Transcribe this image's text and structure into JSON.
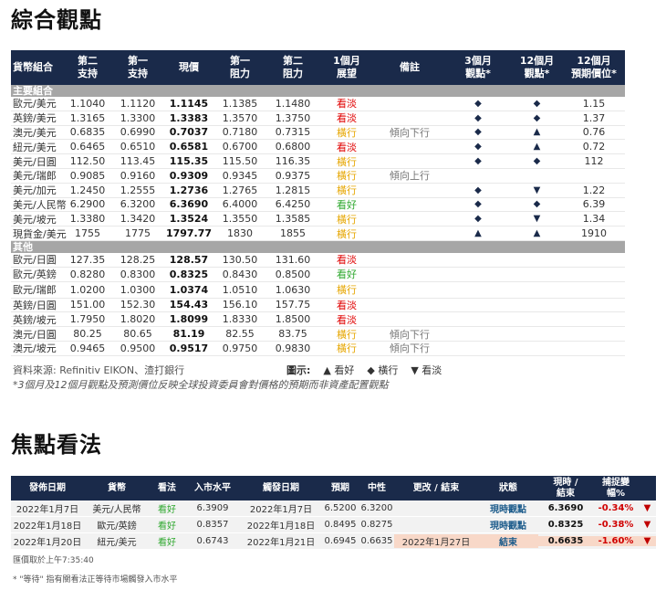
{
  "title1": "綜合觀點",
  "table1": {
    "headers": [
      "貨幣組合",
      "第二\n支持",
      "第一\n支持",
      "現價",
      "第一\n阻力",
      "第二\n阻力",
      "1個月\n展望",
      "備註",
      "3個月\n觀點*",
      "12個月\n觀點*",
      "12個月\n預期價位*"
    ],
    "section_main": "主要組合",
    "main_rows": [
      {
        "pair": "歐元/美元",
        "s2": "1.1040",
        "s1": "1.1120",
        "px": "1.1145",
        "r1": "1.1385",
        "r2": "1.1480",
        "outlook": "看淡",
        "tone": "bear",
        "note": "",
        "m3": "◆",
        "m12": "◆",
        "target": "1.15"
      },
      {
        "pair": "英鎊/美元",
        "s2": "1.3165",
        "s1": "1.3300",
        "px": "1.3383",
        "r1": "1.3570",
        "r2": "1.3750",
        "outlook": "看淡",
        "tone": "bear",
        "note": "",
        "m3": "◆",
        "m12": "◆",
        "target": "1.37"
      },
      {
        "pair": "澳元/美元",
        "s2": "0.6835",
        "s1": "0.6990",
        "px": "0.7037",
        "r1": "0.7180",
        "r2": "0.7315",
        "outlook": "橫行",
        "tone": "neut",
        "note": "傾向下行",
        "m3": "◆",
        "m12": "▲",
        "target": "0.76"
      },
      {
        "pair": "紐元/美元",
        "s2": "0.6465",
        "s1": "0.6510",
        "px": "0.6581",
        "r1": "0.6700",
        "r2": "0.6800",
        "outlook": "看淡",
        "tone": "bear",
        "note": "",
        "m3": "◆",
        "m12": "▲",
        "target": "0.72"
      },
      {
        "pair": "美元/日圓",
        "s2": "112.50",
        "s1": "113.45",
        "px": "115.35",
        "r1": "115.50",
        "r2": "116.35",
        "outlook": "橫行",
        "tone": "neut",
        "note": "",
        "m3": "◆",
        "m12": "◆",
        "target": "112"
      },
      {
        "pair": "美元/瑞郎",
        "s2": "0.9085",
        "s1": "0.9160",
        "px": "0.9309",
        "r1": "0.9345",
        "r2": "0.9375",
        "outlook": "橫行",
        "tone": "neut",
        "note": "傾向上行",
        "m3": "",
        "m12": "",
        "target": ""
      },
      {
        "pair": "美元/加元",
        "s2": "1.2450",
        "s1": "1.2555",
        "px": "1.2736",
        "r1": "1.2765",
        "r2": "1.2815",
        "outlook": "橫行",
        "tone": "neut",
        "note": "",
        "m3": "◆",
        "m12": "▼",
        "target": "1.22"
      },
      {
        "pair": "美元/人民幣",
        "s2": "6.2900",
        "s1": "6.3200",
        "px": "6.3690",
        "r1": "6.4000",
        "r2": "6.4250",
        "outlook": "看好",
        "tone": "bull",
        "note": "",
        "m3": "◆",
        "m12": "◆",
        "target": "6.39"
      },
      {
        "pair": "美元/坡元",
        "s2": "1.3380",
        "s1": "1.3420",
        "px": "1.3524",
        "r1": "1.3550",
        "r2": "1.3585",
        "outlook": "橫行",
        "tone": "neut",
        "note": "",
        "m3": "◆",
        "m12": "▼",
        "target": "1.34"
      },
      {
        "pair": "現貨金/美元",
        "s2": "1755",
        "s1": "1775",
        "px": "1797.77",
        "r1": "1830",
        "r2": "1855",
        "outlook": "橫行",
        "tone": "neut",
        "note": "",
        "m3": "▲",
        "m12": "▲",
        "target": "1910"
      }
    ],
    "section_other": "其他",
    "other_rows": [
      {
        "pair": "歐元/日圓",
        "s2": "127.35",
        "s1": "128.25",
        "px": "128.57",
        "r1": "130.50",
        "r2": "131.60",
        "outlook": "看淡",
        "tone": "bear",
        "note": "",
        "tall": false
      },
      {
        "pair": "歐元/英鎊",
        "s2": "0.8280",
        "s1": "0.8300",
        "px": "0.8325",
        "r1": "0.8430",
        "r2": "0.8500",
        "outlook": "看好",
        "tone": "bull",
        "note": "",
        "tall": false
      },
      {
        "pair": "歐元/瑞郎",
        "s2": "1.0200",
        "s1": "1.0300",
        "px": "1.0374",
        "r1": "1.0510",
        "r2": "1.0630",
        "outlook": "橫行",
        "tone": "neut",
        "note": "",
        "tall": true
      },
      {
        "pair": "英鎊/日圓",
        "s2": "151.00",
        "s1": "152.30",
        "px": "154.43",
        "r1": "156.10",
        "r2": "157.75",
        "outlook": "看淡",
        "tone": "bear",
        "note": "",
        "tall": false
      },
      {
        "pair": "英鎊/坡元",
        "s2": "1.7950",
        "s1": "1.8020",
        "px": "1.8099",
        "r1": "1.8330",
        "r2": "1.8500",
        "outlook": "看淡",
        "tone": "bear",
        "note": "",
        "tall": false
      },
      {
        "pair": "澳元/日圓",
        "s2": "80.25",
        "s1": "80.65",
        "px": "81.19",
        "r1": "82.55",
        "r2": "83.75",
        "outlook": "橫行",
        "tone": "neut",
        "note": "傾向下行",
        "tall": false
      },
      {
        "pair": "澳元/坡元",
        "s2": "0.9465",
        "s1": "0.9500",
        "px": "0.9517",
        "r1": "0.9750",
        "r2": "0.9830",
        "outlook": "橫行",
        "tone": "neut",
        "note": "傾向下行",
        "tall": false
      }
    ],
    "source": "資料來源: Refinitiv EIKON、渣打銀行",
    "legend_title": "圖示:",
    "legend_up": "▲ 看好",
    "legend_side": "◆ 橫行",
    "legend_down": "▼ 看淡",
    "footnote": "*3個月及12個月觀點及預測價位反映全球投資委員會對價格的預期而非資產配置觀點"
  },
  "title2": "焦點看法",
  "table2": {
    "headers": [
      "發佈日期",
      "貨幣",
      "看法",
      "入市水平",
      "觸發日期",
      "預期",
      "中性",
      "更改 / 結束",
      "狀態",
      "現時 /\n結束",
      "捕捉變幅%",
      ""
    ],
    "rows": [
      {
        "date": "2022年1月7日",
        "pair": "美元/人民幣",
        "view": "看好",
        "entry": "6.3909",
        "trigger": "2022年1月7日",
        "target": "6.5200",
        "neutral": "6.3200",
        "change": "",
        "status": "現時觀點",
        "current": "6.3690",
        "pct": "-0.34%",
        "arrow": "▼",
        "hl": false
      },
      {
        "date": "2022年1月18日",
        "pair": "歐元/英鎊",
        "view": "看好",
        "entry": "0.8357",
        "trigger": "2022年1月18日",
        "target": "0.8495",
        "neutral": "0.8275",
        "change": "",
        "status": "現時觀點",
        "current": "0.8325",
        "pct": "-0.38%",
        "arrow": "▼",
        "hl": false
      },
      {
        "date": "2022年1月20日",
        "pair": "紐元/美元",
        "view": "看好",
        "entry": "0.6743",
        "trigger": "2022年1月21日",
        "target": "0.6945",
        "neutral": "0.6635",
        "change": "2022年1月27日",
        "status": "結束",
        "current": "0.6635",
        "pct": "-1.60%",
        "arrow": "▼",
        "hl": true
      }
    ],
    "quote_time": "匯價取於上午7:35:40",
    "note": "* \"等待\" 指有關看法正等待市場觸發入市水平"
  }
}
